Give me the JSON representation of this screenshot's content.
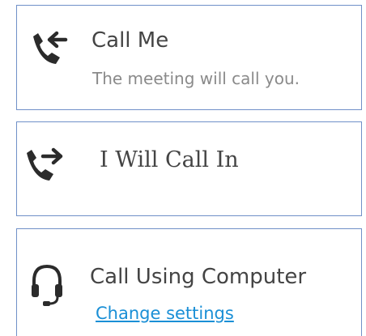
{
  "options": {
    "call_me": {
      "title": "Call Me",
      "description": "The meeting will call you."
    },
    "call_in": {
      "title": "I Will Call In"
    },
    "computer": {
      "title": "Call Using Computer",
      "link": "Change settings"
    }
  },
  "icons": {
    "call_me": "phone-incoming-icon",
    "call_in": "phone-outgoing-icon",
    "computer": "headset-icon"
  },
  "colors": {
    "border": "#7090c8",
    "title": "#444444",
    "subtitle": "#8a8a8a",
    "link": "#1a8fd6",
    "icon": "#2b2b2b"
  }
}
